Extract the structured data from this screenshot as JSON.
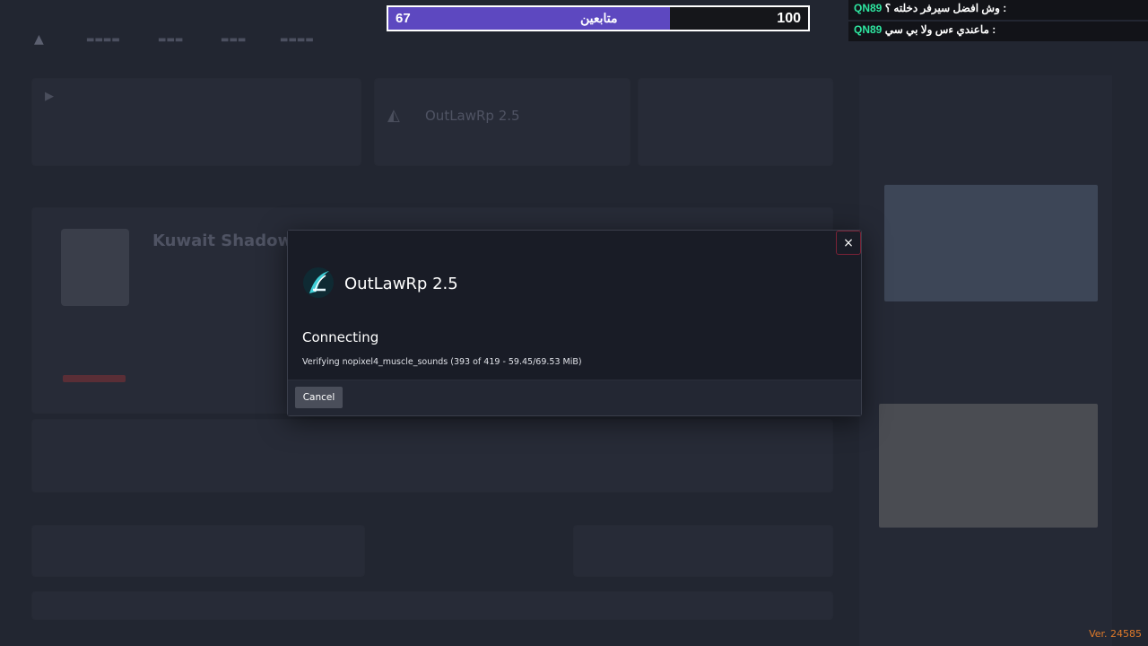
{
  "goal": {
    "current": "67",
    "label": "متابعين",
    "target": "100",
    "progress": 0.67,
    "fill_color": "#5d48c0"
  },
  "chat": [
    {
      "user": "QN89",
      "message": "وش افضل سيرفر دخلته ؟ :"
    },
    {
      "user": "QN89",
      "message": "ماعندي ءس ولا بي سي :"
    }
  ],
  "background": {
    "server_card_title": "OutLawRp 2.5",
    "featured_server_title": "Kuwait Shadow"
  },
  "modal": {
    "server_name": "OutLawRp 2.5",
    "status": "Connecting",
    "detail": "Verifying nopixel4_muscle_sounds (393 of 419 - 59.45/69.53 MiB)",
    "cancel_label": "Cancel",
    "close_icon": "×",
    "icon": "server-logo-icon"
  },
  "version": "Ver. 24585",
  "colors": {
    "accent_green": "#2ee6a0",
    "version_orange": "#e07a2a",
    "close_border": "#7a2236"
  }
}
